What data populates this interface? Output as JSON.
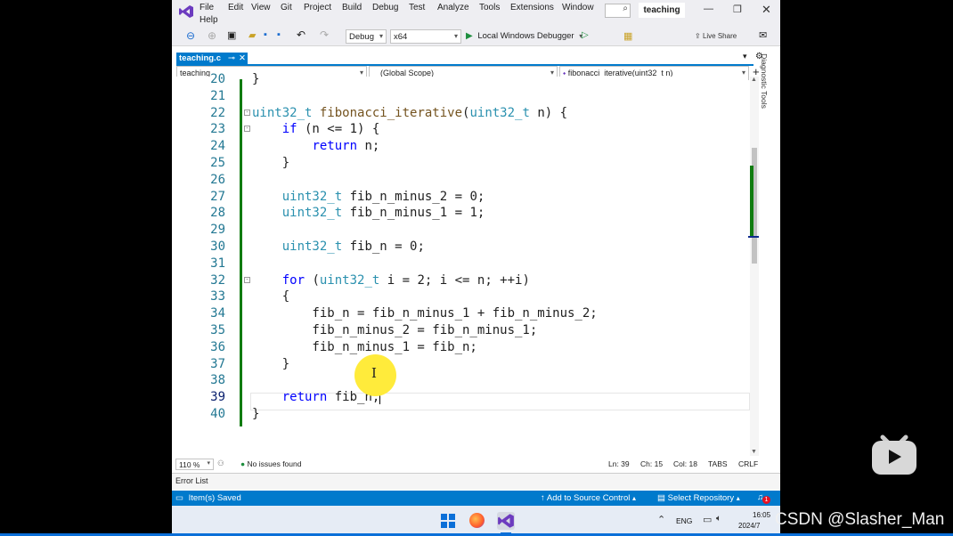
{
  "menu": {
    "items": [
      "File",
      "Edit",
      "View",
      "Git",
      "Project",
      "Build",
      "Debug",
      "Test",
      "Analyze",
      "Tools",
      "Extensions",
      "Window",
      "Help"
    ],
    "search_icon": "search-icon",
    "solution_name": "teaching"
  },
  "toolbar": {
    "config": "Debug",
    "platform": "x64",
    "run_label": "Local Windows Debugger",
    "live_share": "Live Share"
  },
  "tab": {
    "label": "teaching.c"
  },
  "navbar": {
    "project": "teaching",
    "scope": "(Global Scope)",
    "member": "fibonacci_iterative(uint32_t n)"
  },
  "side_panel": {
    "label": "Diagnostic Tools"
  },
  "code": {
    "line_numbers": [
      "20",
      "21",
      "22",
      "23",
      "24",
      "25",
      "26",
      "27",
      "28",
      "29",
      "30",
      "31",
      "32",
      "33",
      "34",
      "35",
      "36",
      "37",
      "38",
      "39",
      "40"
    ],
    "current_line": "39",
    "lines": [
      "}",
      "",
      "uint32_t fibonacci_iterative(uint32_t n) {",
      "    if (n <= 1) {",
      "        return n;",
      "    }",
      "",
      "    uint32_t fib_n_minus_2 = 0;",
      "    uint32_t fib_n_minus_1 = 1;",
      "",
      "    uint32_t fib_n = 0;",
      "",
      "    for (uint32_t i = 2; i <= n; ++i)",
      "    {",
      "        fib_n = fib_n_minus_1 + fib_n_minus_2;",
      "        fib_n_minus_2 = fib_n_minus_1;",
      "        fib_n_minus_1 = fib_n;",
      "    }",
      "",
      "    return fib_n;",
      "}"
    ]
  },
  "editor_status": {
    "zoom": "110 %",
    "issues": "No issues found",
    "line": "Ln: 39",
    "char": "Ch: 15",
    "col": "Col: 18",
    "tabs": "TABS",
    "eol": "CRLF"
  },
  "error_list": "Error List",
  "statusbar": {
    "saved": "Item(s) Saved",
    "source_control": "Add to Source Control",
    "repository": "Select Repository",
    "notifications": "1"
  },
  "taskbar": {
    "lang": "ENG",
    "time": "16:05",
    "date": "2024/7"
  },
  "watermark": "CSDN @Slasher_Man",
  "colors": {
    "accent": "#007acc",
    "keyword": "#0000ff",
    "type": "#2b91af",
    "change_bar": "#107c10",
    "highlight": "#ffeb3b"
  }
}
